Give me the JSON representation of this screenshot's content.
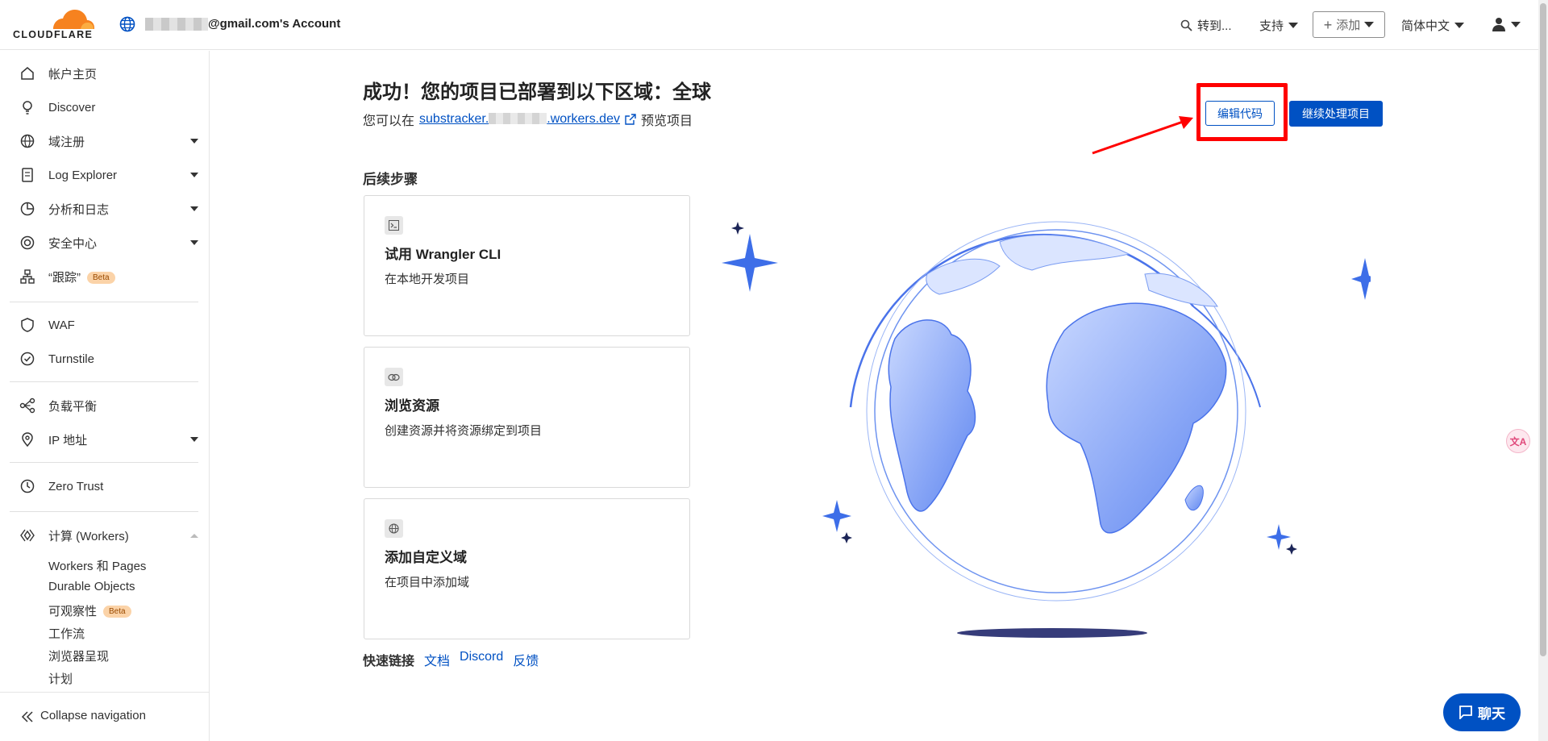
{
  "header": {
    "brand": "CLOUDFLARE",
    "account_suffix": "@gmail.com's Account",
    "goto": "转到...",
    "support": "支持",
    "add": "添加",
    "language": "简体中文"
  },
  "sidebar": {
    "items": [
      {
        "label": "帐户主页",
        "icon": "home-icon"
      },
      {
        "label": "Discover",
        "icon": "lightbulb-icon"
      },
      {
        "label": "域注册",
        "icon": "globe-icon"
      },
      {
        "label": "Log Explorer",
        "icon": "document-icon"
      },
      {
        "label": "分析和日志",
        "icon": "pie-chart-icon"
      },
      {
        "label": "安全中心",
        "icon": "shield-icon"
      },
      {
        "label": "“跟踪”",
        "icon": "sitemap-icon",
        "badge": "Beta"
      },
      {
        "label": "WAF",
        "icon": "waf-shield-icon"
      },
      {
        "label": "Turnstile",
        "icon": "turnstile-icon"
      },
      {
        "label": "负载平衡",
        "icon": "load-balancer-icon"
      },
      {
        "label": "IP 地址",
        "icon": "location-pin-icon"
      },
      {
        "label": "Zero Trust",
        "icon": "zero-trust-icon"
      },
      {
        "label": "计算 (Workers)",
        "icon": "workers-icon"
      }
    ],
    "sub_items": [
      {
        "label": "Workers 和 Pages"
      },
      {
        "label": "Durable Objects"
      },
      {
        "label": "可观察性",
        "badge": "Beta"
      },
      {
        "label": "工作流"
      },
      {
        "label": "浏览器呈现"
      },
      {
        "label": "计划"
      }
    ],
    "collapse": "Collapse navigation"
  },
  "main": {
    "title": "成功！您的项目已部署到以下区域：全球",
    "sub_prefix": "您可以在",
    "url_start": "substracker.",
    "url_end": ".workers.dev",
    "sub_suffix": "预览项目",
    "edit_button": "编辑代码",
    "continue_button": "继续处理项目",
    "steps_title": "后续步骤",
    "cards": [
      {
        "title": "试用 Wrangler CLI",
        "desc": "在本地开发项目",
        "icon": "terminal-icon"
      },
      {
        "title": "浏览资源",
        "desc": "创建资源并将资源绑定到项目",
        "icon": "link-icon"
      },
      {
        "title": "添加自定义域",
        "desc": "在项目中添加域",
        "icon": "globe-icon"
      }
    ],
    "quicklinks": {
      "title": "快速链接",
      "links": [
        "文档",
        "Discord",
        "反馈"
      ]
    }
  },
  "chat": {
    "label": "聊天"
  }
}
